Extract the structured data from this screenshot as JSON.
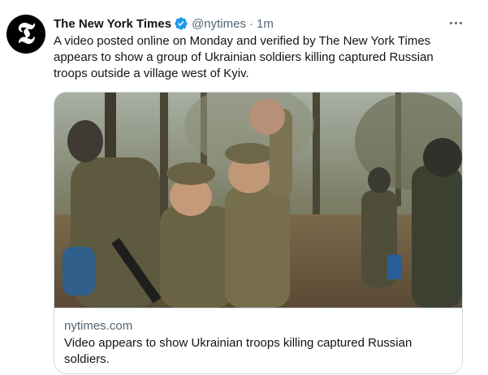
{
  "tweet": {
    "avatar_glyph": "𝕿",
    "author_name": "The New York Times",
    "handle": "@nytimes",
    "separator": "·",
    "time": "1m",
    "verified_icon": "verified-badge-icon",
    "more_icon": "more-options-icon",
    "text": "A video posted online on Monday and verified by The New York Times appears to show a group of Ukrainian soldiers killing captured Russian troops outside a village west of Kyiv."
  },
  "card": {
    "domain": "nytimes.com",
    "title": "Video appears to show Ukrainian troops killing captured Russian soldiers."
  },
  "colors": {
    "verified_blue": "#1d9bf0",
    "secondary_text": "#536471",
    "border": "#cfd9de"
  }
}
